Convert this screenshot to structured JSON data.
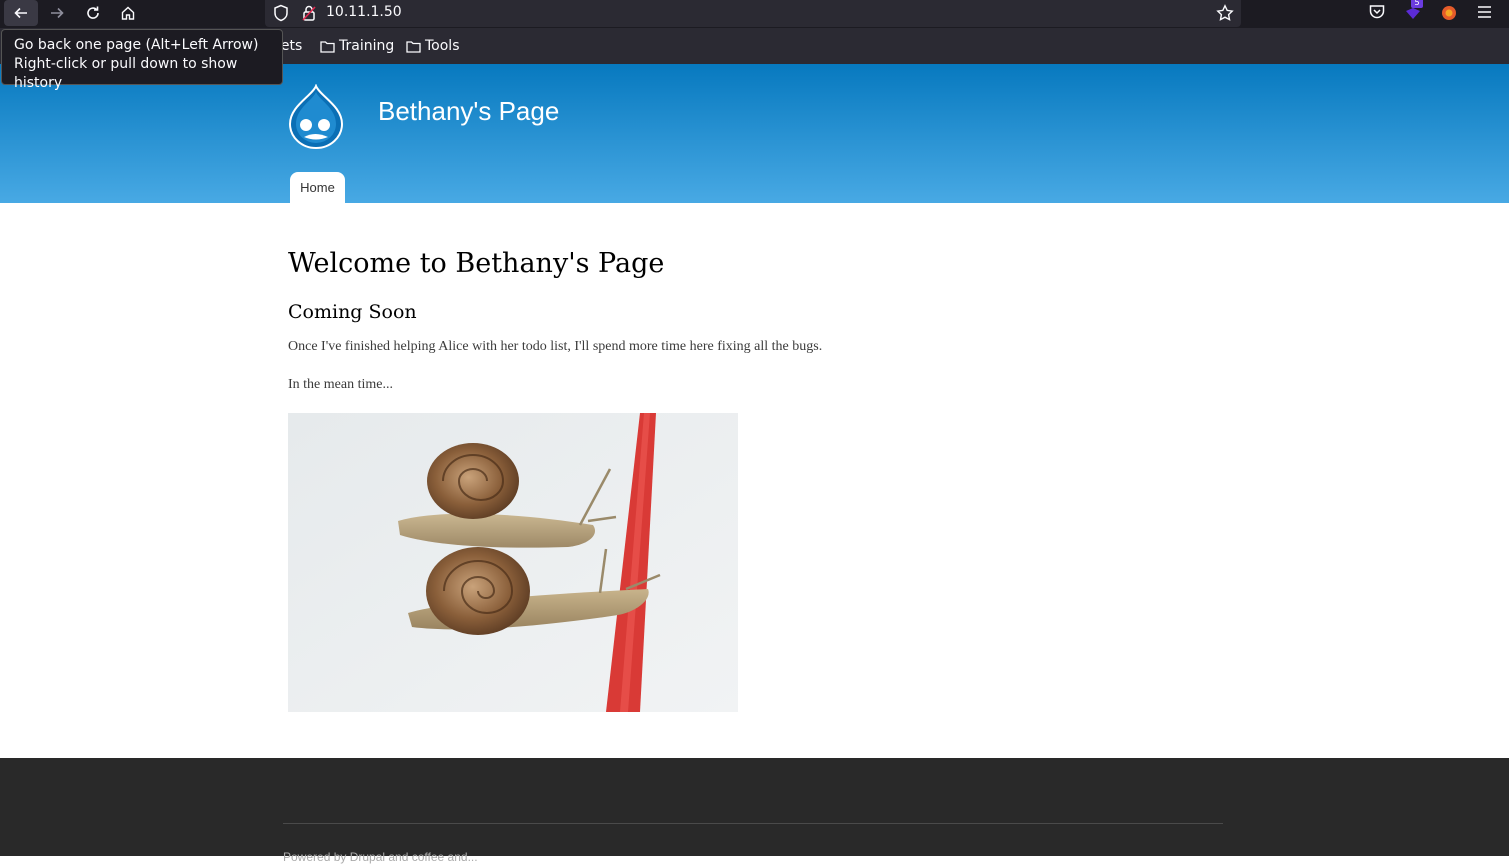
{
  "browser": {
    "url": "10.11.1.50",
    "bookmarks": [
      {
        "label": "eat sheets"
      },
      {
        "label": "Training"
      },
      {
        "label": "Tools"
      }
    ],
    "tooltip": {
      "line1": "Go back one page (Alt+Left Arrow)",
      "line2": "Right-click or pull down to show history"
    },
    "extension_badge": "5"
  },
  "site": {
    "name": "Bethany's Page",
    "nav": [
      {
        "label": "Home"
      }
    ]
  },
  "main": {
    "title": "Welcome to Bethany's Page",
    "subtitle": "Coming Soon",
    "paragraph1": "Once I've finished helping Alice with her todo list, I'll spend more time here fixing all the bugs.",
    "paragraph2": "In the mean time..."
  },
  "footer": {
    "text": "Powered by Drupal and coffee and..."
  },
  "colors": {
    "header_top": "#0779bf",
    "header_bottom": "#48a9e4",
    "footer_bg": "#292929",
    "chrome_bg": "#1c1b22"
  }
}
